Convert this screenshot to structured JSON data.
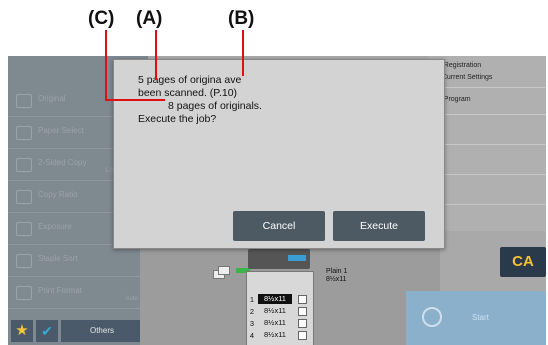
{
  "callouts": {
    "c": "(C)",
    "a": "(A)",
    "b": "(B)"
  },
  "dialog": {
    "line1": "5 pages of origina  ave",
    "line2": "been scanned. (P.10)",
    "line3": "8 pages of originals.",
    "line4": "Execute the job?",
    "cancel_label": "Cancel",
    "execute_label": "Execute"
  },
  "sidebar": {
    "items": [
      {
        "label": "Original",
        "sub": ""
      },
      {
        "label": "Paper Select",
        "sub": ""
      },
      {
        "label": "2-Sided Copy",
        "sub": "1-Sided → 1"
      },
      {
        "label": "Copy Ratio",
        "sub": ""
      },
      {
        "label": "Exposure",
        "sub": ""
      },
      {
        "label": "Staple Sort",
        "sub": ""
      },
      {
        "label": "Print Format",
        "sub": "Auto"
      }
    ],
    "others_label": "Others"
  },
  "right_panel": {
    "line1": "m Registration",
    "line2": "e Current Settings",
    "line3": "to Program"
  },
  "trays": [
    {
      "num": "1",
      "size": "8½x11"
    },
    {
      "num": "2",
      "size": "8½x11"
    },
    {
      "num": "3",
      "size": "8½x11"
    },
    {
      "num": "4",
      "size": "8½x11"
    }
  ],
  "bypass": {
    "line1": "Plain 1",
    "line2": "8½x11"
  },
  "ca_label": "CA",
  "start_label": "Start",
  "colors": {
    "screen_bg": "#a9a9a9",
    "dialog_bg": "#d3d3d3",
    "button_bg": "#4e5a63",
    "leader_line": "#dd1111",
    "ca_text": "#f2c232"
  }
}
